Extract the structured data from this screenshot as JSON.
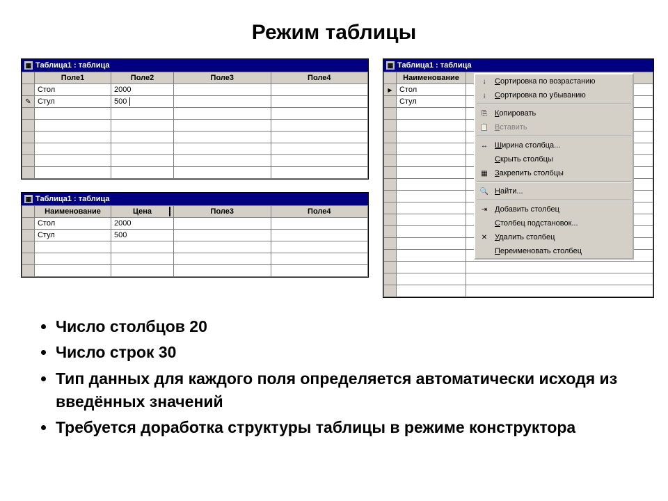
{
  "title": "Режим таблицы",
  "window1": {
    "title": "Таблица1 : таблица",
    "headers": [
      "Поле1",
      "Поле2",
      "Поле3",
      "Поле4"
    ],
    "rows": [
      {
        "marker": "",
        "c1": "Стол",
        "c2": "2000",
        "c3": "",
        "c4": ""
      },
      {
        "marker": "✎",
        "c1": "Стул",
        "c2": "500",
        "c3": "",
        "c4": ""
      }
    ]
  },
  "window2": {
    "title": "Таблица1 : таблица",
    "headers": [
      "Наименование",
      "Цена",
      "Поле3",
      "Поле4"
    ],
    "rows": [
      {
        "marker": "",
        "c1": "Стол",
        "c2": "2000",
        "c3": "",
        "c4": ""
      },
      {
        "marker": "",
        "c1": "Стул",
        "c2": "500",
        "c3": "",
        "c4": ""
      }
    ]
  },
  "window3": {
    "title": "Таблица1 : таблица",
    "header1": "Наименование",
    "rows": [
      {
        "c1": "Стол"
      },
      {
        "c1": "Стул"
      }
    ]
  },
  "context_menu": {
    "items": [
      {
        "icon": "sort-asc-icon",
        "glyph": "↓",
        "label": "Сортировка по возрастанию",
        "enabled": true
      },
      {
        "icon": "sort-desc-icon",
        "glyph": "↓",
        "label": "Сортировка по убыванию",
        "enabled": true
      },
      {
        "sep": true
      },
      {
        "icon": "copy-icon",
        "glyph": "⎘",
        "label": "Копировать",
        "enabled": true
      },
      {
        "icon": "paste-icon",
        "glyph": "📋",
        "label": "Вставить",
        "enabled": false
      },
      {
        "sep": true
      },
      {
        "icon": "width-icon",
        "glyph": "↔",
        "label": "Ширина столбца...",
        "enabled": true
      },
      {
        "icon": "",
        "glyph": "",
        "label": "Скрыть столбцы",
        "enabled": true
      },
      {
        "icon": "freeze-icon",
        "glyph": "▦",
        "label": "Закрепить столбцы",
        "enabled": true
      },
      {
        "sep": true
      },
      {
        "icon": "find-icon",
        "glyph": "🔍",
        "label": "Найти...",
        "enabled": true
      },
      {
        "sep": true
      },
      {
        "icon": "insert-col-icon",
        "glyph": "⇥",
        "label": "Добавить столбец",
        "enabled": true
      },
      {
        "icon": "",
        "glyph": "",
        "label": "Столбец подстановок...",
        "enabled": true
      },
      {
        "icon": "delete-col-icon",
        "glyph": "✕",
        "label": "Удалить столбец",
        "enabled": true
      },
      {
        "icon": "",
        "glyph": "",
        "label": "Переименовать столбец",
        "enabled": true
      }
    ]
  },
  "bullets": [
    "Число столбцов 20",
    "Число строк 30",
    "Тип данных для каждого поля определяется автоматически исходя из введённых значений",
    "Требуется доработка структуры таблицы в режиме конструктора"
  ]
}
